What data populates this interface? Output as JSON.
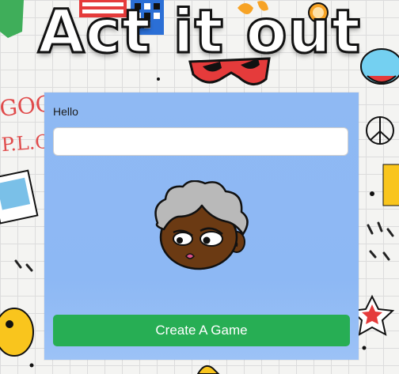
{
  "title": "Act it out",
  "form": {
    "greeting": "Hello",
    "name_value": "",
    "create_button_label": "Create A Game"
  },
  "background": {
    "doodle_text_left_1": "GOGO",
    "doodle_text_left_2": "P.L.O"
  },
  "colors": {
    "panel": "#8fb9f3",
    "button": "#27ae54",
    "title_fill": "#ffffff",
    "title_stroke": "#111111"
  },
  "icons": [
    "avatar-character-icon",
    "peace-sign-icon",
    "sunglasses-icon",
    "orange-slice-icon",
    "star-icon"
  ]
}
